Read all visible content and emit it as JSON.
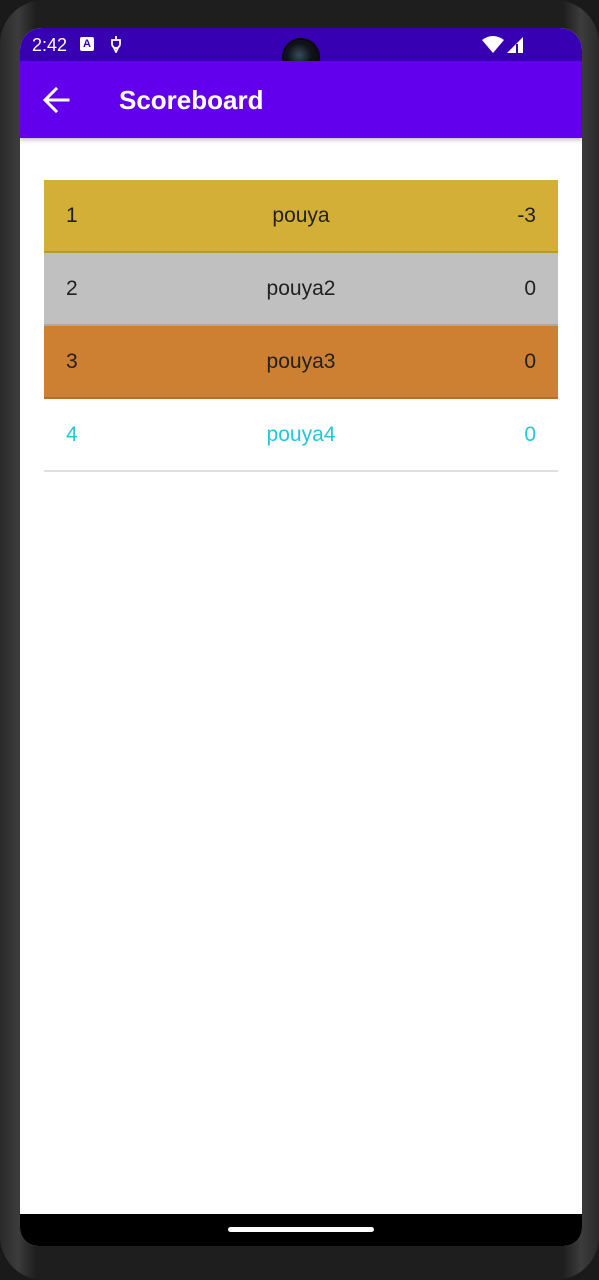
{
  "status_bar": {
    "time": "2:42",
    "notification_icons": [
      "app-a-icon",
      "usb-debug-icon"
    ],
    "wifi_icon": "wifi-icon",
    "signal_icon": "cell-signal-icon",
    "background": "#3700b3"
  },
  "app_bar": {
    "title": "Scoreboard",
    "back_icon": "arrow-back-icon",
    "background": "#6200ee"
  },
  "scoreboard": {
    "rows": [
      {
        "rank": "1",
        "name": "pouya",
        "score": "-3",
        "background": "#d4af37",
        "text_color": "#212121"
      },
      {
        "rank": "2",
        "name": "pouya2",
        "score": "0",
        "background": "#c0c0c0",
        "text_color": "#212121"
      },
      {
        "rank": "3",
        "name": "pouya3",
        "score": "0",
        "background": "#cd7f32",
        "text_color": "#212121"
      },
      {
        "rank": "4",
        "name": "pouya4",
        "score": "0",
        "background": "#ffffff",
        "text_color": "#26c6da"
      }
    ]
  },
  "nav_bar": {
    "handle": "gesture-handle"
  }
}
